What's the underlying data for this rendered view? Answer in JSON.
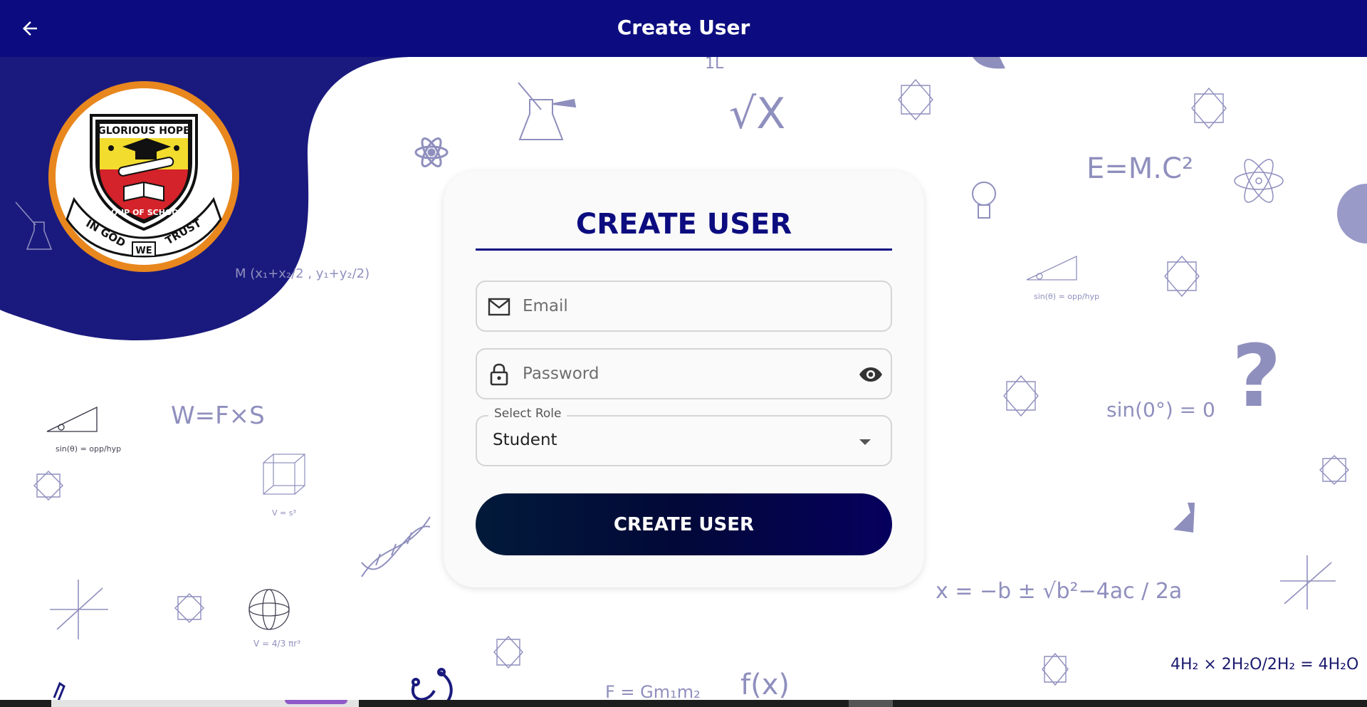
{
  "appbar": {
    "title": "Create User",
    "back_icon": "arrow-left-icon"
  },
  "logo": {
    "top_text": "GLORIOUS HOPE",
    "band_text": "GROUP OF SCHOOLS",
    "motto": [
      "IN GOD",
      "WE",
      "TRUST"
    ]
  },
  "background": {
    "formulas": [
      "1L",
      "√X",
      "E=M.C²",
      "M (x₁+x₂/2 , y₁+y₂/2)",
      "W=F×S",
      "sin(0°) = 0",
      "x = −b ± √b²−4ac / 2a",
      "4H₂ × 2H₂O/2H₂ = 4H₂O",
      "F = Gm₁m₂",
      "f(x)",
      "V = s³",
      "V = 4/3 πr³",
      "sin(θ) = opp/hyp"
    ]
  },
  "form": {
    "title": "CREATE USER",
    "email": {
      "placeholder": "Email",
      "value": "",
      "icon": "mail-icon"
    },
    "password": {
      "placeholder": "Password",
      "value": "",
      "icon": "lock-icon",
      "toggle_icon": "eye-icon"
    },
    "role": {
      "label": "Select Role",
      "value": "Student",
      "icon": "caret-down-icon"
    },
    "submit_label": "CREATE USER"
  },
  "colors": {
    "primary": "#0c0c80",
    "logo_ring": "#e8871e",
    "doodle": "#8f8fbe",
    "card_bg": "#fafafa"
  }
}
